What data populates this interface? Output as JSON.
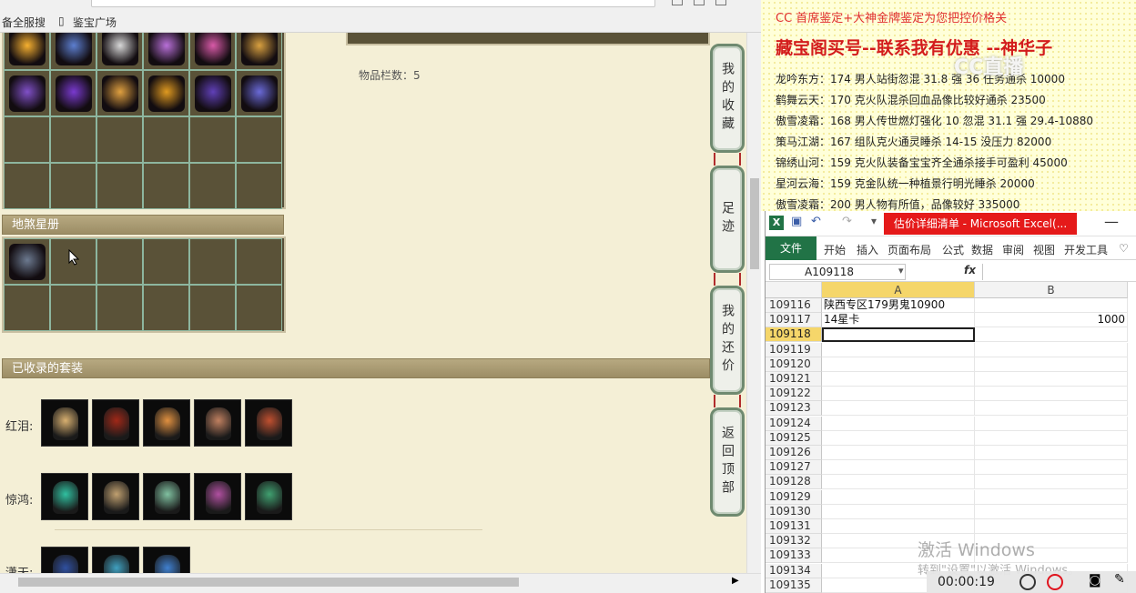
{
  "browser": {
    "bookmarks": [
      "备全服搜",
      "鉴宝广场"
    ]
  },
  "game": {
    "slots_label": "物品栏数：5",
    "section_constellation": "地煞星册",
    "section_sets": "已收录的套装",
    "sets": [
      {
        "label": "红泪:"
      },
      {
        "label": "惊鸿:"
      },
      {
        "label": "潇天:"
      }
    ],
    "side_buttons": [
      "我的收藏",
      "足迹",
      "我的还价",
      "返回顶部"
    ]
  },
  "notice": {
    "head1": "CC 首席鉴定+大神金牌鉴定为您把控价格关",
    "head2": "藏宝阁买号--联系我有优惠 --神华子",
    "lines": [
      "龙吟东方：174 男人站街忽混 31.8 强 36 任务通杀 10000",
      "鹤舞云天：170 克火队混杀回血品像比较好通杀 23500",
      "傲雪凌霜：168 男人传世燃灯强化 10 忽混 31.1 强 29.4-10880",
      "策马江湖：167 组队克火通灵睡杀 14-15 没压力 82000",
      "锦绣山河：159 克火队装备宝宝齐全通杀接手可盈利 45000",
      "星河云海：159 克金队统一种植景行明光睡杀 20000",
      "傲雪凌霜：200 男人物有所值，品像较好 335000"
    ],
    "watermark_logo": "CC直播"
  },
  "excel": {
    "title": "估价详细清单 - Microsoft Excel(...",
    "file_tab": "文件",
    "tabs": [
      "开始",
      "插入",
      "页面布局",
      "公式",
      "数据",
      "审阅",
      "视图",
      "开发工具"
    ],
    "name_box": "A109118",
    "fx": "fx",
    "columns": [
      "A",
      "B"
    ],
    "rows": [
      {
        "n": "109116",
        "a": "陕西专区179男鬼10900",
        "b": ""
      },
      {
        "n": "109117",
        "a": "14星卡",
        "b": "1000"
      },
      {
        "n": "109118",
        "a": "",
        "b": ""
      },
      {
        "n": "109119",
        "a": "",
        "b": ""
      },
      {
        "n": "109120",
        "a": "",
        "b": ""
      },
      {
        "n": "109121",
        "a": "",
        "b": ""
      },
      {
        "n": "109122",
        "a": "",
        "b": ""
      },
      {
        "n": "109123",
        "a": "",
        "b": ""
      },
      {
        "n": "109124",
        "a": "",
        "b": ""
      },
      {
        "n": "109125",
        "a": "",
        "b": ""
      },
      {
        "n": "109126",
        "a": "",
        "b": ""
      },
      {
        "n": "109127",
        "a": "",
        "b": ""
      },
      {
        "n": "109128",
        "a": "",
        "b": ""
      },
      {
        "n": "109129",
        "a": "",
        "b": ""
      },
      {
        "n": "109130",
        "a": "",
        "b": ""
      },
      {
        "n": "109131",
        "a": "",
        "b": ""
      },
      {
        "n": "109132",
        "a": "",
        "b": ""
      },
      {
        "n": "109133",
        "a": "",
        "b": ""
      },
      {
        "n": "109134",
        "a": "",
        "b": ""
      },
      {
        "n": "109135",
        "a": "",
        "b": ""
      }
    ],
    "active_row": "109118"
  },
  "overlay": {
    "activate_windows": "激活 Windows",
    "activate_hint": "转到\"设置\"以激活 Windows。",
    "recorder_time": "00:00:19"
  },
  "colors": {
    "excel_green": "#217346",
    "title_red": "#e51a1a",
    "notice_red": "#d31c1c"
  }
}
